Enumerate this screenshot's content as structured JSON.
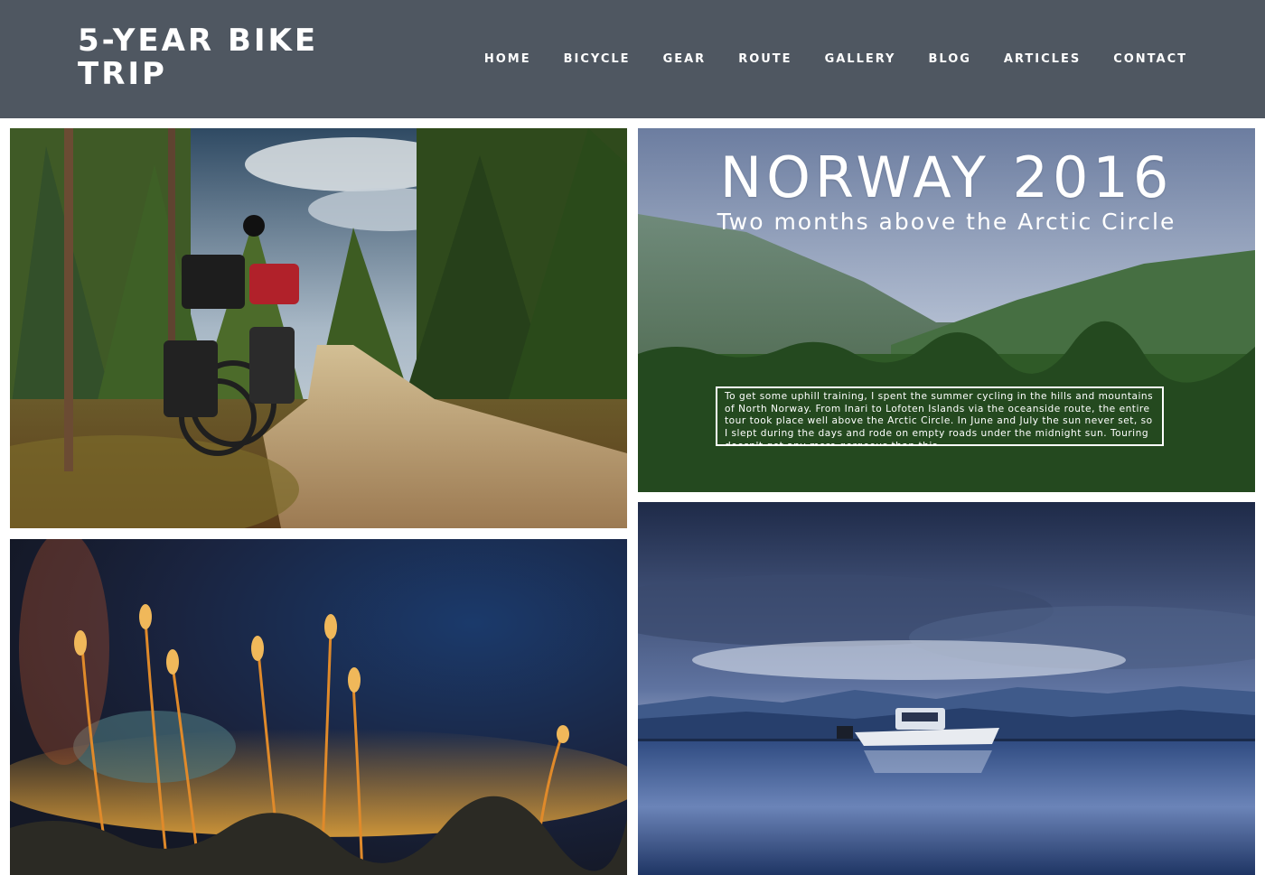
{
  "header": {
    "site_title": "5-YEAR BIKE TRIP",
    "nav": [
      "HOME",
      "BICYCLE",
      "GEAR",
      "ROUTE",
      "GALLERY",
      "BLOG",
      "ARTICLES",
      "CONTACT"
    ],
    "background_color": "#4f5761"
  },
  "tiles": {
    "norway": {
      "title": "NORWAY 2016",
      "subtitle": "Two months above the Arctic Circle",
      "description": "To get some uphill training, I spent the summer cycling in the hills and mountains of North Norway. From Inari to Lofoten Islands via the oceanside route, the entire tour took place well above the Arctic Circle. In June and July the sun never set, so I slept during the days and rode on empty roads under the midnight sun. Touring doesn't get any more gorgeous than this."
    }
  }
}
